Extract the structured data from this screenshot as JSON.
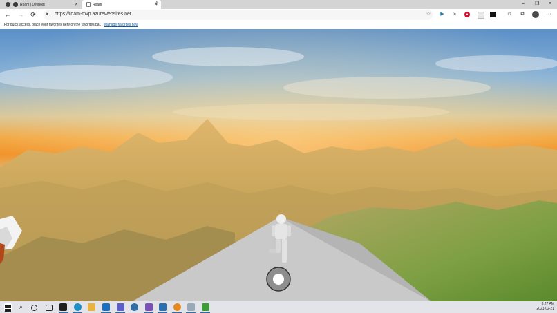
{
  "browser": {
    "tabs": [
      {
        "label": "Roam | Devpost",
        "active": false
      },
      {
        "label": "Roam",
        "active": true
      }
    ],
    "new_tab_glyph": "+",
    "address": {
      "url": "https://roam-mvp.azurewebsites.net"
    },
    "window_controls": {
      "minimize": "–",
      "maximize": "❐",
      "close": "✕"
    },
    "favorites_bar": {
      "message": "For quick access, place your favorites here on the favorites bar.",
      "link": "Manage favorites now"
    },
    "extension_icons": [
      "add-favorite-icon",
      "play-extension-icon",
      "forward-extension-icon",
      "red-extension-icon",
      "gray-extension-icon",
      "imdb-extension-icon",
      "favorites-icon",
      "collections-icon",
      "profile-avatar-icon",
      "more-menu-icon"
    ]
  },
  "game": {
    "scene": "sky-clouds-terrain",
    "joystick": "virtual-joystick"
  },
  "taskbar": {
    "time": "8:27 AM",
    "date": "2021-02-21",
    "apps": [
      "start-icon",
      "search-icon",
      "cortana-icon",
      "task-view-icon",
      "terminal-icon",
      "edge-icon",
      "file-explorer-icon",
      "outlook-icon",
      "teams-icon",
      "chrome-like-icon",
      "visual-studio-icon",
      "monitor-icon",
      "blender-icon",
      "mail-icon",
      "node-icon"
    ]
  },
  "colors": {
    "tab_bar": "#d4d4d4",
    "accent_link": "#0b5cad",
    "taskbar": "#e3e4ea"
  }
}
